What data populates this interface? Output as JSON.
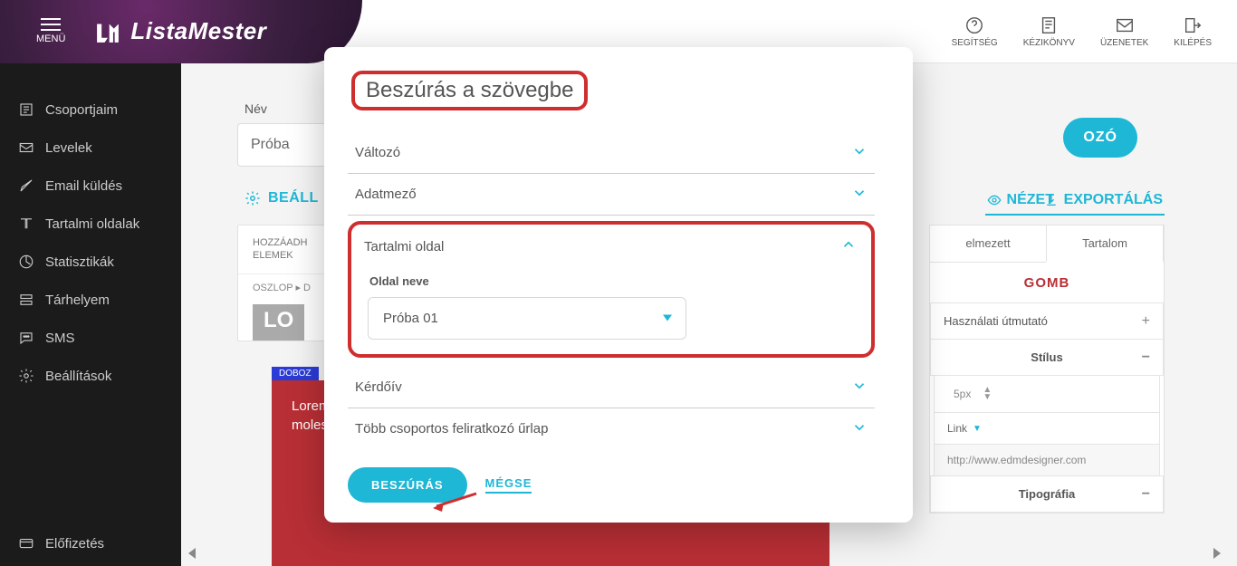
{
  "header": {
    "menu_label": "MENÜ",
    "logo_text": "ListaMester",
    "buttons": {
      "help": "SEGÍTSÉG",
      "manual": "KÉZIKÖNYV",
      "messages": "ÜZENETEK",
      "logout": "KILÉPÉS"
    }
  },
  "sidebar": {
    "items": [
      "Csoportjaim",
      "Levelek",
      "Email küldés",
      "Tartalmi oldalak",
      "Statisztikák",
      "Tárhelyem",
      "SMS",
      "Beállítások",
      "Előfizetés"
    ]
  },
  "editor": {
    "name_label": "Név",
    "name_value": "Próba",
    "pill_end": "OZÓ",
    "settings": "BEÁLL",
    "preview": "NÉZET",
    "export": "EXPORTÁLÁS",
    "panel_head1": "HOZZÁADH",
    "panel_head2": "ELEMEK",
    "crumb": "OSZLOP ▸ D",
    "lo": "LO",
    "doboz": "DOBOZ",
    "lorem": "Lorem ipsum dolor sit amet, consectetur adipiscing elit. Nulla facilisi. Morbi sed molestie. Maecenas et purus in velit."
  },
  "props": {
    "tab1": "elmezett",
    "tab2": "Tartalom",
    "title": "GOMB",
    "usage": "Használati útmutató",
    "style": "Stílus",
    "px": "5px",
    "link": "Link",
    "url": "http://www.edmdesigner.com",
    "typo": "Tipográfia"
  },
  "modal": {
    "title": "Beszúrás a szövegbe",
    "items": {
      "variable": "Változó",
      "datafield": "Adatmező",
      "content_page": "Tartalmi oldal",
      "page_name_label": "Oldal neve",
      "page_selected": "Próba 01",
      "survey": "Kérdőív",
      "multi_signup": "Több csoportos feliratkozó űrlap"
    },
    "actions": {
      "insert": "BESZÚRÁS",
      "cancel": "MÉGSE"
    }
  }
}
